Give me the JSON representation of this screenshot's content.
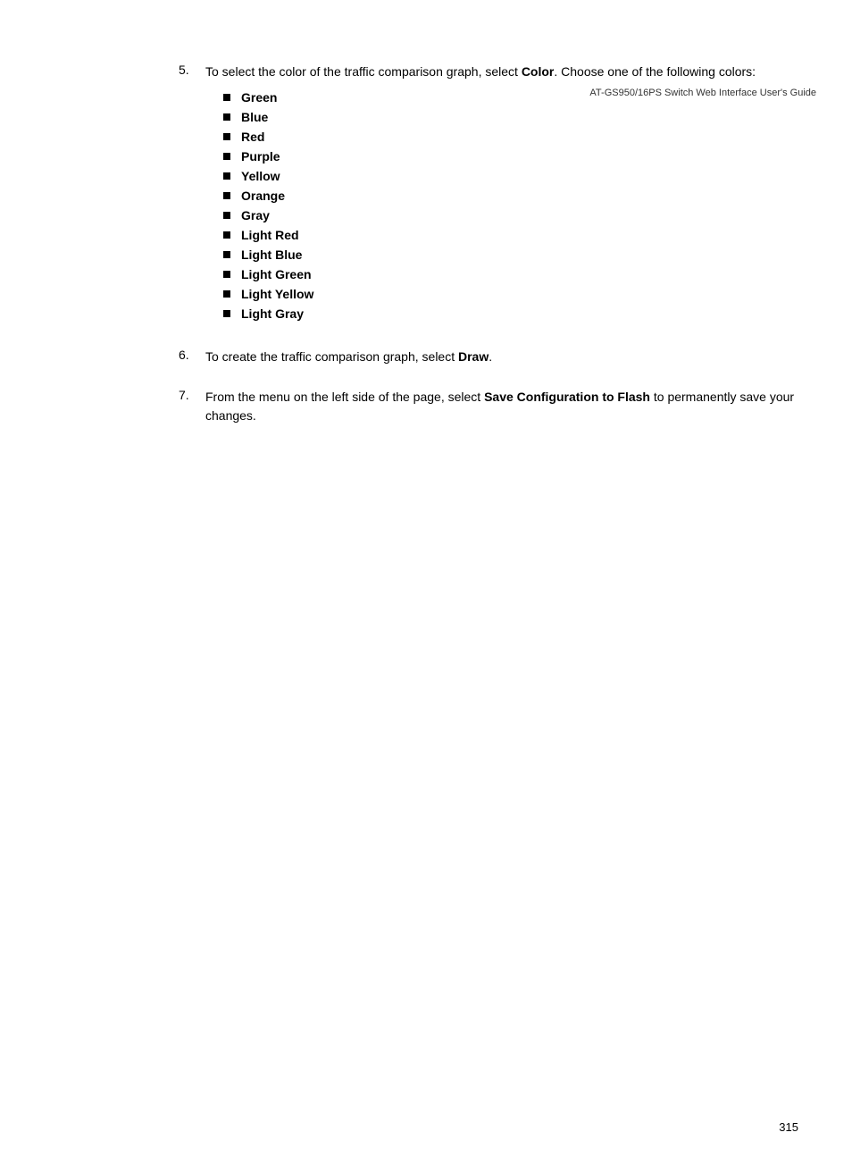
{
  "header": {
    "title": "AT-GS950/16PS Switch Web Interface User's Guide"
  },
  "content": {
    "steps": [
      {
        "number": "5.",
        "text_before": "To select the color of the traffic comparison graph, select ",
        "bold_word": "Color",
        "text_after": ". Choose one of the following colors:",
        "has_list": true,
        "list_items": [
          "Green",
          "Blue",
          "Red",
          "Purple",
          "Yellow",
          "Orange",
          "Gray",
          "Light Red",
          "Light Blue",
          "Light Green",
          "Light Yellow",
          "Light Gray"
        ]
      },
      {
        "number": "6.",
        "text_before": "To create the traffic comparison graph, select ",
        "bold_word": "Draw",
        "text_after": ".",
        "has_list": false
      },
      {
        "number": "7.",
        "text_before": "From the menu on the left side of the page, select ",
        "bold_word": "Save Configuration to Flash",
        "text_after": " to permanently save your changes.",
        "has_list": false
      }
    ]
  },
  "footer": {
    "page_number": "315"
  }
}
